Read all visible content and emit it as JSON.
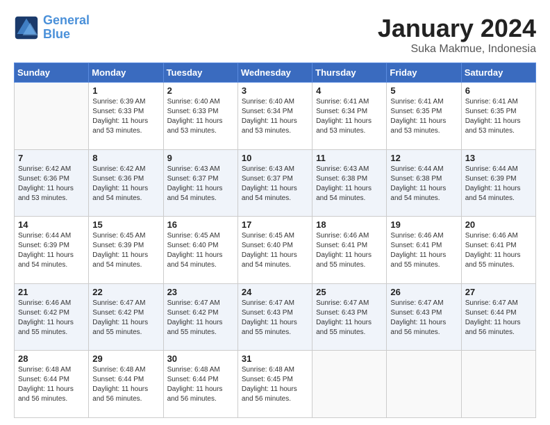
{
  "header": {
    "logo_line1": "General",
    "logo_line2": "Blue",
    "month": "January 2024",
    "location": "Suka Makmue, Indonesia"
  },
  "days_of_week": [
    "Sunday",
    "Monday",
    "Tuesday",
    "Wednesday",
    "Thursday",
    "Friday",
    "Saturday"
  ],
  "weeks": [
    [
      {
        "day": "",
        "info": ""
      },
      {
        "day": "1",
        "info": "Sunrise: 6:39 AM\nSunset: 6:33 PM\nDaylight: 11 hours\nand 53 minutes."
      },
      {
        "day": "2",
        "info": "Sunrise: 6:40 AM\nSunset: 6:33 PM\nDaylight: 11 hours\nand 53 minutes."
      },
      {
        "day": "3",
        "info": "Sunrise: 6:40 AM\nSunset: 6:34 PM\nDaylight: 11 hours\nand 53 minutes."
      },
      {
        "day": "4",
        "info": "Sunrise: 6:41 AM\nSunset: 6:34 PM\nDaylight: 11 hours\nand 53 minutes."
      },
      {
        "day": "5",
        "info": "Sunrise: 6:41 AM\nSunset: 6:35 PM\nDaylight: 11 hours\nand 53 minutes."
      },
      {
        "day": "6",
        "info": "Sunrise: 6:41 AM\nSunset: 6:35 PM\nDaylight: 11 hours\nand 53 minutes."
      }
    ],
    [
      {
        "day": "7",
        "info": "Sunrise: 6:42 AM\nSunset: 6:36 PM\nDaylight: 11 hours\nand 53 minutes."
      },
      {
        "day": "8",
        "info": "Sunrise: 6:42 AM\nSunset: 6:36 PM\nDaylight: 11 hours\nand 54 minutes."
      },
      {
        "day": "9",
        "info": "Sunrise: 6:43 AM\nSunset: 6:37 PM\nDaylight: 11 hours\nand 54 minutes."
      },
      {
        "day": "10",
        "info": "Sunrise: 6:43 AM\nSunset: 6:37 PM\nDaylight: 11 hours\nand 54 minutes."
      },
      {
        "day": "11",
        "info": "Sunrise: 6:43 AM\nSunset: 6:38 PM\nDaylight: 11 hours\nand 54 minutes."
      },
      {
        "day": "12",
        "info": "Sunrise: 6:44 AM\nSunset: 6:38 PM\nDaylight: 11 hours\nand 54 minutes."
      },
      {
        "day": "13",
        "info": "Sunrise: 6:44 AM\nSunset: 6:39 PM\nDaylight: 11 hours\nand 54 minutes."
      }
    ],
    [
      {
        "day": "14",
        "info": "Sunrise: 6:44 AM\nSunset: 6:39 PM\nDaylight: 11 hours\nand 54 minutes."
      },
      {
        "day": "15",
        "info": "Sunrise: 6:45 AM\nSunset: 6:39 PM\nDaylight: 11 hours\nand 54 minutes."
      },
      {
        "day": "16",
        "info": "Sunrise: 6:45 AM\nSunset: 6:40 PM\nDaylight: 11 hours\nand 54 minutes."
      },
      {
        "day": "17",
        "info": "Sunrise: 6:45 AM\nSunset: 6:40 PM\nDaylight: 11 hours\nand 54 minutes."
      },
      {
        "day": "18",
        "info": "Sunrise: 6:46 AM\nSunset: 6:41 PM\nDaylight: 11 hours\nand 55 minutes."
      },
      {
        "day": "19",
        "info": "Sunrise: 6:46 AM\nSunset: 6:41 PM\nDaylight: 11 hours\nand 55 minutes."
      },
      {
        "day": "20",
        "info": "Sunrise: 6:46 AM\nSunset: 6:41 PM\nDaylight: 11 hours\nand 55 minutes."
      }
    ],
    [
      {
        "day": "21",
        "info": "Sunrise: 6:46 AM\nSunset: 6:42 PM\nDaylight: 11 hours\nand 55 minutes."
      },
      {
        "day": "22",
        "info": "Sunrise: 6:47 AM\nSunset: 6:42 PM\nDaylight: 11 hours\nand 55 minutes."
      },
      {
        "day": "23",
        "info": "Sunrise: 6:47 AM\nSunset: 6:42 PM\nDaylight: 11 hours\nand 55 minutes."
      },
      {
        "day": "24",
        "info": "Sunrise: 6:47 AM\nSunset: 6:43 PM\nDaylight: 11 hours\nand 55 minutes."
      },
      {
        "day": "25",
        "info": "Sunrise: 6:47 AM\nSunset: 6:43 PM\nDaylight: 11 hours\nand 55 minutes."
      },
      {
        "day": "26",
        "info": "Sunrise: 6:47 AM\nSunset: 6:43 PM\nDaylight: 11 hours\nand 56 minutes."
      },
      {
        "day": "27",
        "info": "Sunrise: 6:47 AM\nSunset: 6:44 PM\nDaylight: 11 hours\nand 56 minutes."
      }
    ],
    [
      {
        "day": "28",
        "info": "Sunrise: 6:48 AM\nSunset: 6:44 PM\nDaylight: 11 hours\nand 56 minutes."
      },
      {
        "day": "29",
        "info": "Sunrise: 6:48 AM\nSunset: 6:44 PM\nDaylight: 11 hours\nand 56 minutes."
      },
      {
        "day": "30",
        "info": "Sunrise: 6:48 AM\nSunset: 6:44 PM\nDaylight: 11 hours\nand 56 minutes."
      },
      {
        "day": "31",
        "info": "Sunrise: 6:48 AM\nSunset: 6:45 PM\nDaylight: 11 hours\nand 56 minutes."
      },
      {
        "day": "",
        "info": ""
      },
      {
        "day": "",
        "info": ""
      },
      {
        "day": "",
        "info": ""
      }
    ]
  ]
}
